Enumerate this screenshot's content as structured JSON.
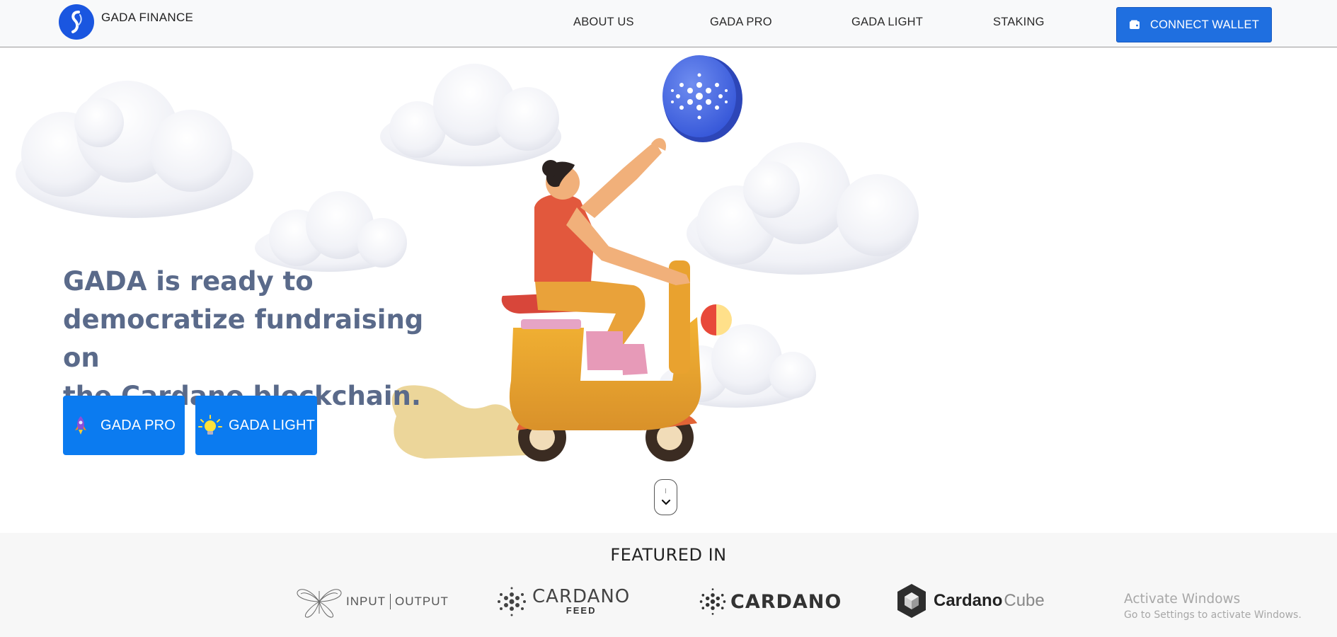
{
  "brand": {
    "name": "GADA FINANCE"
  },
  "nav": {
    "links": [
      "ABOUT US",
      "GADA PRO",
      "GADA LIGHT",
      "STAKING"
    ],
    "connect_label": "CONNECT WALLET"
  },
  "hero": {
    "heading_lines": [
      "GADA is ready to",
      "democratize fundraising on",
      "the Cardano blockchain."
    ],
    "buttons": [
      {
        "label": "GADA PRO",
        "icon": "rocket-icon"
      },
      {
        "label": "GADA LIGHT",
        "icon": "lightbulb-icon"
      }
    ]
  },
  "featured": {
    "title": "FEATURED IN",
    "logos": [
      {
        "name": "input-output",
        "text_left": "INPUT",
        "text_right": "OUTPUT"
      },
      {
        "name": "cardano-feed",
        "text": "CARDANO",
        "subtext": "FEED"
      },
      {
        "name": "cardano",
        "text": "CARDANO"
      },
      {
        "name": "cardano-cube",
        "text_bold": "Cardano",
        "text_light": "Cube"
      }
    ]
  },
  "system_overlay": {
    "title": "Activate Windows",
    "subtitle": "Go to Settings to activate Windows."
  },
  "colors": {
    "primary": "#0b7bf0",
    "connect_button": "#1f6fe0",
    "heading": "#5a6a8a",
    "logo_blue": "#1a56e0"
  }
}
